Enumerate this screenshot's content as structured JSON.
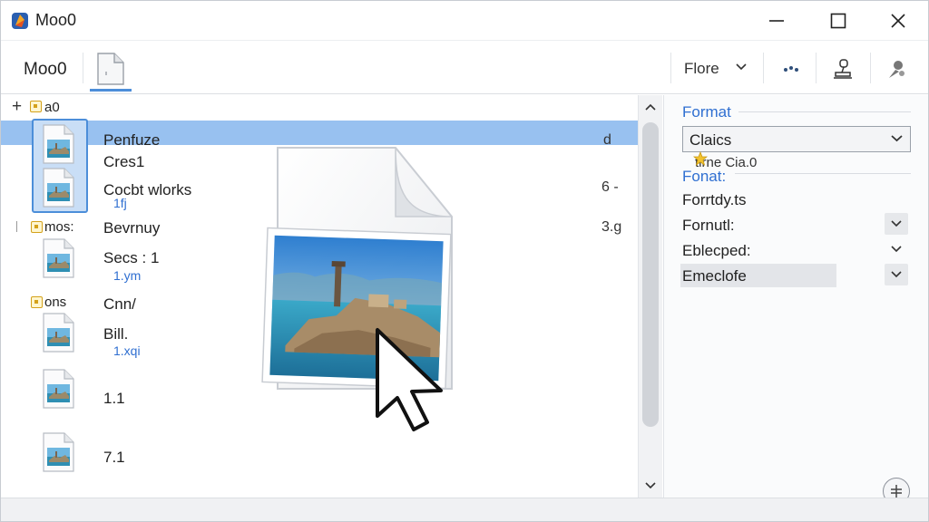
{
  "window": {
    "title": "Moo0",
    "colors": {
      "accent": "#4c8ed9",
      "selection": "#98c1f0",
      "link": "#2f6fd1"
    }
  },
  "window_controls": {
    "minimize_icon": "minimize-icon",
    "maximize_icon": "maximize-icon",
    "close_icon": "close-icon"
  },
  "toolbar": {
    "label": "Moo0",
    "file_button_icon": "document-icon",
    "dropdown_label": "Flore",
    "icons": [
      "more-icon",
      "stamp-icon",
      "user-icon"
    ]
  },
  "tree": {
    "header_label": "a0",
    "groups": [
      {
        "label": "mos:"
      },
      {
        "label": "ons"
      }
    ]
  },
  "files": [
    {
      "name": "Penfuze",
      "sub": "",
      "size": "d"
    },
    {
      "name": "Cres1",
      "sub": "",
      "size": ""
    },
    {
      "name": "Cocbt wlorks",
      "sub": "1fj",
      "size": "6 -"
    },
    {
      "name": "Bevrnuy",
      "sub": "",
      "size": "3.g"
    },
    {
      "name": "Secs : 1",
      "sub": "1.ym",
      "size": ""
    },
    {
      "name": "Cnn/",
      "sub": "",
      "size": ""
    },
    {
      "name": "Bill.",
      "sub": "1.xqi",
      "size": ""
    },
    {
      "name": "1.1",
      "sub": "",
      "size": ""
    },
    {
      "name": "7.1",
      "sub": "",
      "size": ""
    }
  ],
  "props": {
    "section1_title": "Format",
    "select_value": "Claics",
    "select_hint": "tirne Cia.0",
    "section2_title": "Fonat:",
    "rows": [
      {
        "label": "Forrtdy.ts"
      },
      {
        "label": "Fornutl:"
      },
      {
        "label": "Eblecped:"
      },
      {
        "label": "Emeclofe"
      }
    ]
  }
}
